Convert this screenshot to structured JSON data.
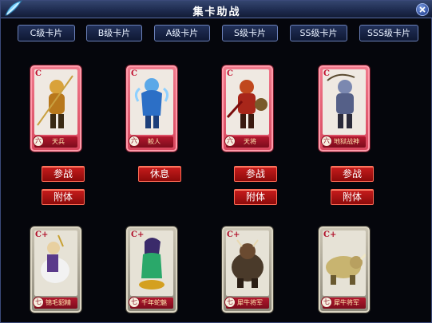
{
  "window": {
    "title": "集卡助战",
    "close": "close"
  },
  "tabs": [
    {
      "label": "C级卡片"
    },
    {
      "label": "B级卡片"
    },
    {
      "label": "A级卡片"
    },
    {
      "label": "S级卡片"
    },
    {
      "label": "SS级卡片"
    },
    {
      "label": "SSS级卡片"
    }
  ],
  "cards_row1": [
    {
      "grade": "C",
      "name": "天兵",
      "star": "六",
      "primary_button": "参战",
      "secondary_button": "附体"
    },
    {
      "grade": "C",
      "name": "鲛人",
      "star": "六",
      "primary_button": "休息"
    },
    {
      "grade": "C",
      "name": "天将",
      "star": "六",
      "primary_button": "参战",
      "secondary_button": "附体"
    },
    {
      "grade": "C",
      "name": "地狱战神",
      "star": "六",
      "primary_button": "参战",
      "secondary_button": "附体"
    }
  ],
  "cards_row2": [
    {
      "grade": "C+",
      "name": "锦毛貂精",
      "star": "七"
    },
    {
      "grade": "C+",
      "name": "千年蛇魅",
      "star": "七"
    },
    {
      "grade": "C+",
      "name": "犀牛将军",
      "star": "七"
    },
    {
      "grade": "C+",
      "name": "犀牛将军",
      "star": "七"
    }
  ],
  "colors": {
    "red_card": "#e05a6e",
    "gray_card": "#a8a293",
    "button_red": "#b51414",
    "tab_border": "#6b80b8"
  }
}
